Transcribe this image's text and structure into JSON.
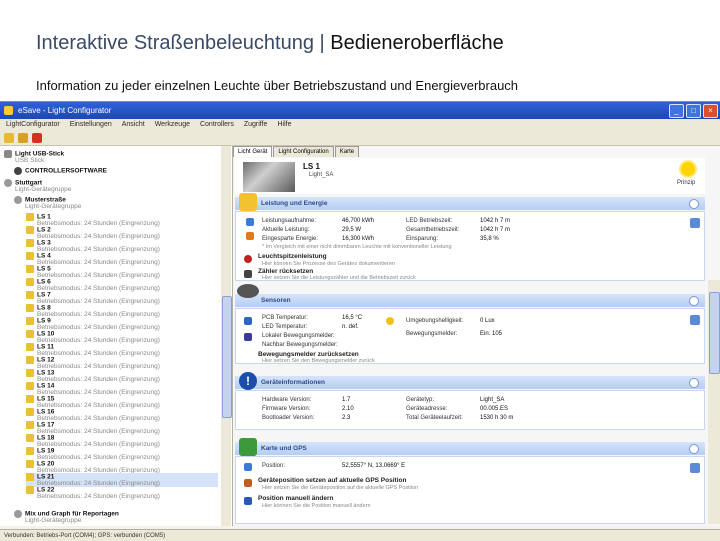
{
  "slide": {
    "title_normal": "Interaktive Straßenbeleuchtung | ",
    "title_strong": "Bedieneroberfläche",
    "subtitle": "Information zu jeder einzelnen Leuchte über Betriebszustand und Energieverbrauch"
  },
  "window": {
    "title": "eSave - Light Configurator",
    "menu": [
      "LightConfigurator",
      "Einstellungen",
      "Ansicht",
      "Werkzeuge",
      "Controllers",
      "Zugriffe",
      "Hilfe"
    ]
  },
  "tree": {
    "root": {
      "label": "Light USB-Stick",
      "sub": "USB Stick"
    },
    "controller": "CONTROLLERSOFTWARE",
    "station": {
      "label": "Stuttgart",
      "sub": "Light-Gerätegruppe"
    },
    "group": {
      "label": "Musterstraße",
      "sub": "Light-Gerätegruppe"
    },
    "item_sub": "Betriebsmodus: 24 Stunden (Eingrenzung)",
    "items": [
      "LS 1",
      "LS 2",
      "LS 3",
      "LS 4",
      "LS 5",
      "LS 6",
      "LS 7",
      "LS 8",
      "LS 9",
      "LS 10",
      "LS 11",
      "LS 12",
      "LS 13",
      "LS 14",
      "LS 15",
      "LS 16",
      "LS 17",
      "LS 18",
      "LS 19",
      "LS 20",
      "LS 21",
      "LS 22"
    ],
    "last_group": {
      "label": "Mix und Graph für Reportagen",
      "sub": "Light-Gerätegruppe"
    }
  },
  "detail": {
    "tabs": [
      "Licht Gerät",
      "Light Configuration",
      "Karte"
    ],
    "name": "LS 1",
    "type": "Light_SA",
    "weather": "Prinzip",
    "energy": {
      "header": "Leistung und Energie",
      "rows": [
        {
          "label": "Leistungsaufnahme:",
          "value": "46,700 kWh",
          "label2": "LED Betriebszeit:",
          "value2": "1042 h 7 m"
        },
        {
          "label": "Aktuelle Leistung:",
          "value": "29,5 W",
          "label2": "Gesamtbetriebszeit:",
          "value2": "1042 h 7 m"
        },
        {
          "label": "Eingesparte Energie:",
          "value": "16,300 kWh",
          "label2": "Einsparung:",
          "value2": "35,8 %"
        }
      ],
      "note": "* Im Vergleich mit einer nicht dimmbaren Leuchte mit konventioneller Leistung",
      "event1_title": "Leuchtspitzenleistung",
      "event1_text": "Hier können Sie Prozesse des Gerätes dokumentieren",
      "event2_title": "Zähler rücksetzen",
      "event2_text": "Hier setzen Sie die Leistungszähler und die Betriebszeit zurück"
    },
    "sensors": {
      "header": "Sensoren",
      "rows": [
        {
          "label": "PCB Temperatur:",
          "value": "16,5 °C",
          "label2": "Umgebungshelligkeit:",
          "value2": "0 Lux"
        },
        {
          "label": "LED Temperatur:",
          "value": "n. def.",
          "label2": "Bewegungsmelder:",
          "value2": "Ein: 105"
        },
        {
          "label": "Lokaler Bewegungsmelder:",
          "value": "",
          "label2": "",
          "value2": ""
        },
        {
          "label": "Nachbar Bewegungsmelder:",
          "value": "",
          "label2": "",
          "value2": ""
        }
      ],
      "event_title": "Bewegungsmelder zurücksetzen",
      "event_text": "Hier setzen Sie den Bewegungsmelder zurück"
    },
    "device": {
      "header": "Geräteinformationen",
      "rows": [
        {
          "label": "Hardware Version:",
          "value": "1.7",
          "label2": "Gerätetyp:",
          "value2": "Light_SA"
        },
        {
          "label": "Firmware Version:",
          "value": "2.10",
          "label2": "Geräteadresse:",
          "value2": "00.005.ES"
        },
        {
          "label": "Bootloader Version:",
          "value": "2.3",
          "label2": "Total Geräteelaufzeit:",
          "value2": "1530 h 30 m"
        }
      ]
    },
    "gps": {
      "header": "Karte und GPS",
      "rows": [
        {
          "label": "Position:",
          "value": "52,5557° N, 13,0669° E"
        }
      ],
      "event1_title": "Geräteposition setzen auf aktuelle GPS Position",
      "event1_text": "Hier setzen Sie die Geräteposition auf die aktuelle GPS Position",
      "event2_title": "Position manuell ändern",
      "event2_text": "Hier können Sie die Position manuell ändern"
    }
  },
  "status": "Verbunden: Betriebs-Port (COM4); GPS: verbunden (COM5)"
}
